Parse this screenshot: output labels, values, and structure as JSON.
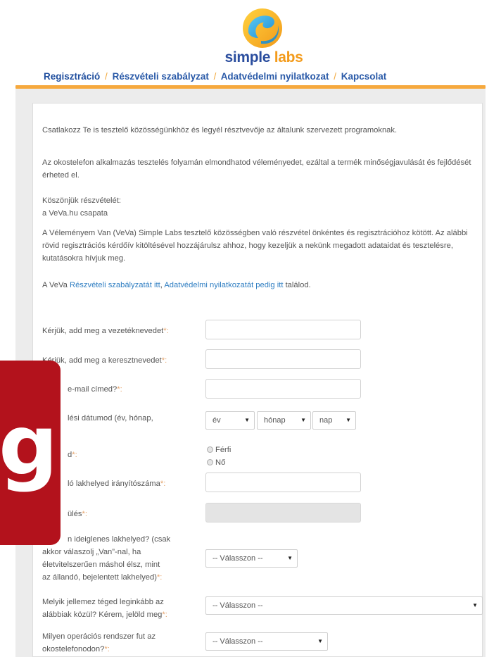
{
  "brand": {
    "name_part1": "simple",
    "name_part2": "labs"
  },
  "nav": [
    {
      "label": "Regisztráció"
    },
    {
      "label": "Részvételi szabályzat"
    },
    {
      "label": "Adatvédelmi nyilatkozat"
    },
    {
      "label": "Kapcsolat"
    }
  ],
  "nav_separator": "/",
  "intro": {
    "p1": "Csatlakozz Te is tesztelő közösségünkhöz és legyél résztvevője az általunk szervezett programoknak.",
    "p2": "Az okostelefon alkalmazás tesztelés folyamán elmondhatod véleményedet, ezáltal a termék minőségjavulását és fejlődését érheted el.",
    "p3_line1": "Köszönjük részvételét:",
    "p3_line2": "a VeVa.hu csapata",
    "p4": "A Véleményem Van (VeVa) Simple Labs tesztelő közösségben való részvétel önkéntes és regisztrációhoz kötött. Az alábbi rövid regisztrációs kérdőív kitöltésével hozzájárulsz ahhoz, hogy kezeljük a nekünk megadott adataidat és tesztelésre, kutatásokra hívjuk meg.",
    "p5_pre": "A VeVa ",
    "p5_link1": "Részvételi szabályzatát itt",
    "p5_mid": ", ",
    "p5_link2": "Adatvédelmi nyilatkozatát pedig itt",
    "p5_post": " találod."
  },
  "form": {
    "req_mark": "*:",
    "lastname_label": "Kérjük, add meg a vezetéknevedet",
    "firstname_label": "Kérjük, add meg a keresztnevedet",
    "email_label": "e-mail címed?",
    "birth_label": "lési dátumod (év, hónap,",
    "birth_year": "év",
    "birth_month": "hónap",
    "birth_day": "nap",
    "gender_label": "d",
    "gender_options": [
      "Férfi",
      "Nő"
    ],
    "zip_label": "ló lakhelyed irányítószáma",
    "city_label": "ülés",
    "temp_label_l1": "n ideiglenes lakhelyed? (csak",
    "temp_label_l2": "akkor válaszolj „Van”-nal, ha",
    "temp_label_l3": "életvitelszerűen máshol élsz, mint",
    "temp_label_l4": "az állandó, bejelentett lakhelyed)",
    "temp_value": "-- Válasszon --",
    "describe_label_l1": "Melyik jellemez téged leginkább az",
    "describe_label_l2": "alábbiak közül? Kérem, jelöld meg",
    "describe_value": "-- Válasszon --",
    "os_label_l1": "Milyen operációs rendszer fut az",
    "os_label_l2": "okostelefonodon?",
    "os_value": "-- Válasszon --"
  },
  "overlay": {
    "glyph": "g"
  },
  "colors": {
    "brand_blue": "#2a4d9e",
    "brand_orange": "#f39b1b",
    "link_blue": "#2f7ec2",
    "overlay_red": "#b3121c"
  }
}
